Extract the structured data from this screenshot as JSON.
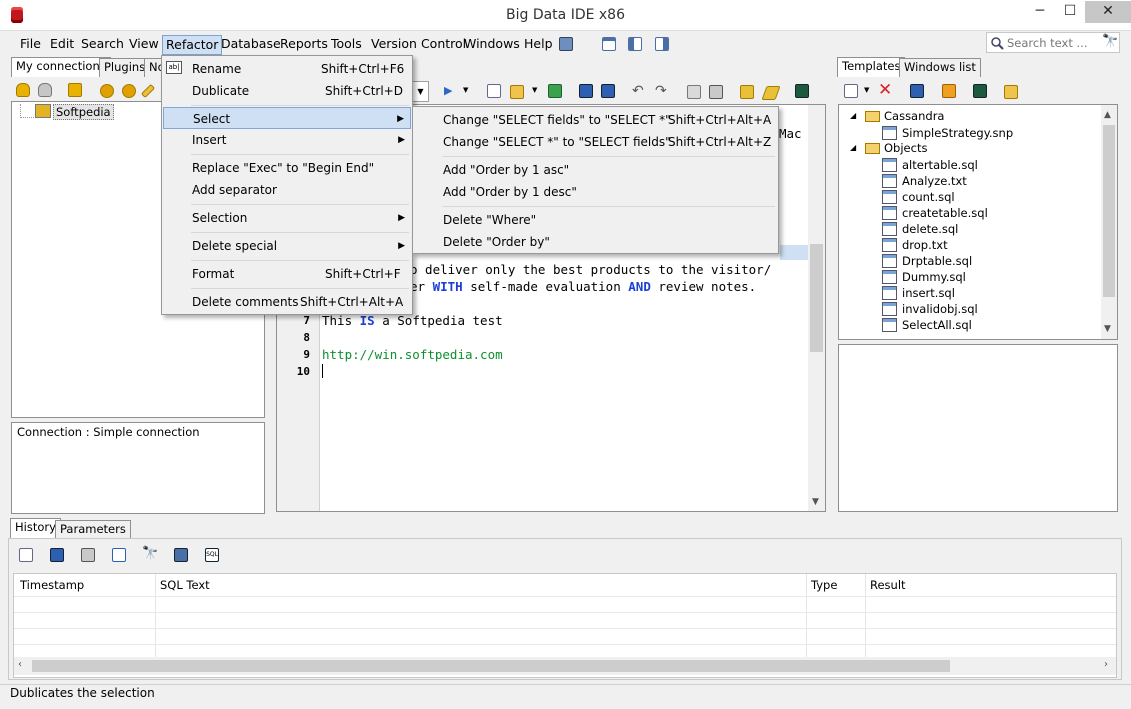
{
  "window": {
    "title": "Big Data IDE x86",
    "minimize": "─",
    "maximize": "☐",
    "close": "✕"
  },
  "menu": [
    "File",
    "Edit",
    "Search",
    "View",
    "Refactor",
    "Database",
    "Reports",
    "Tools",
    "Version Control",
    "Windows",
    "Help"
  ],
  "search": {
    "placeholder": "Search text ..."
  },
  "left_tabs": [
    "My connections",
    "Plugins",
    "No"
  ],
  "tree": {
    "root": "Softpedia"
  },
  "connection_info": "Connection : Simple connection",
  "refactor_menu": [
    {
      "label": "Rename",
      "shortcut": "Shift+Ctrl+F6"
    },
    {
      "label": "Dublicate",
      "shortcut": "Shift+Ctrl+D"
    },
    {
      "label": "Select",
      "shortcut": ""
    },
    {
      "label": "Insert",
      "shortcut": ""
    },
    {
      "label": "Replace \"Exec\" to \"Begin End\"",
      "shortcut": ""
    },
    {
      "label": "Add separator",
      "shortcut": ""
    },
    {
      "label": "Selection",
      "shortcut": ""
    },
    {
      "label": "Delete special",
      "shortcut": ""
    },
    {
      "label": "Format",
      "shortcut": "Shift+Ctrl+F"
    },
    {
      "label": "Delete comments",
      "shortcut": "Shift+Ctrl+Alt+A"
    }
  ],
  "select_submenu": [
    {
      "label": "Change \"SELECT fields\" to \"SELECT *\"",
      "shortcut": "Shift+Ctrl+Alt+A"
    },
    {
      "label": "Change \"SELECT *\" to \"SELECT fields\"",
      "shortcut": "Shift+Ctrl+Alt+Z"
    },
    {
      "label": "Add \"Order by 1 asc\"",
      "shortcut": ""
    },
    {
      "label": "Add \"Order by 1 desc\"",
      "shortcut": ""
    },
    {
      "label": "Delete \"Where\"",
      "shortcut": ""
    },
    {
      "label": "Delete \"Order by\"",
      "shortcut": ""
    }
  ],
  "editor": {
    "lines": [
      "7",
      "8",
      "9",
      "10"
    ],
    "line5_part1": "o deliver only the best products to the visitor/",
    "line6_part1": "er ",
    "line6_kw1": "WITH",
    "line6_part2": " self-made evaluation ",
    "line6_kw2": "AND",
    "line6_part3": " review notes.",
    "line7_part1": "This ",
    "line7_kw": "IS",
    "line7_part2": " a Softpedia test",
    "line9": "http://win.softpedia.com",
    "top_right_fragment": "Mac"
  },
  "right_tabs": [
    "Templates",
    "Windows list"
  ],
  "templates": {
    "cassandra": "Cassandra",
    "cassandra_items": [
      "SimpleStrategy.snp"
    ],
    "objects": "Objects",
    "object_items": [
      "altertable.sql",
      "Analyze.txt",
      "count.sql",
      "createtable.sql",
      "delete.sql",
      "drop.txt",
      "Drptable.sql",
      "Dummy.sql",
      "insert.sql",
      "invalidobj.sql",
      "SelectAll.sql"
    ]
  },
  "bottom_tabs": [
    "History",
    "Parameters"
  ],
  "history_columns": [
    "Timestamp",
    "SQL Text",
    "Type",
    "Result"
  ],
  "status": "Dublicates the selection",
  "colors": {
    "keyword": "#1c3fd6",
    "string": "#0f8f2f",
    "highlight": "#cfe0f4"
  }
}
